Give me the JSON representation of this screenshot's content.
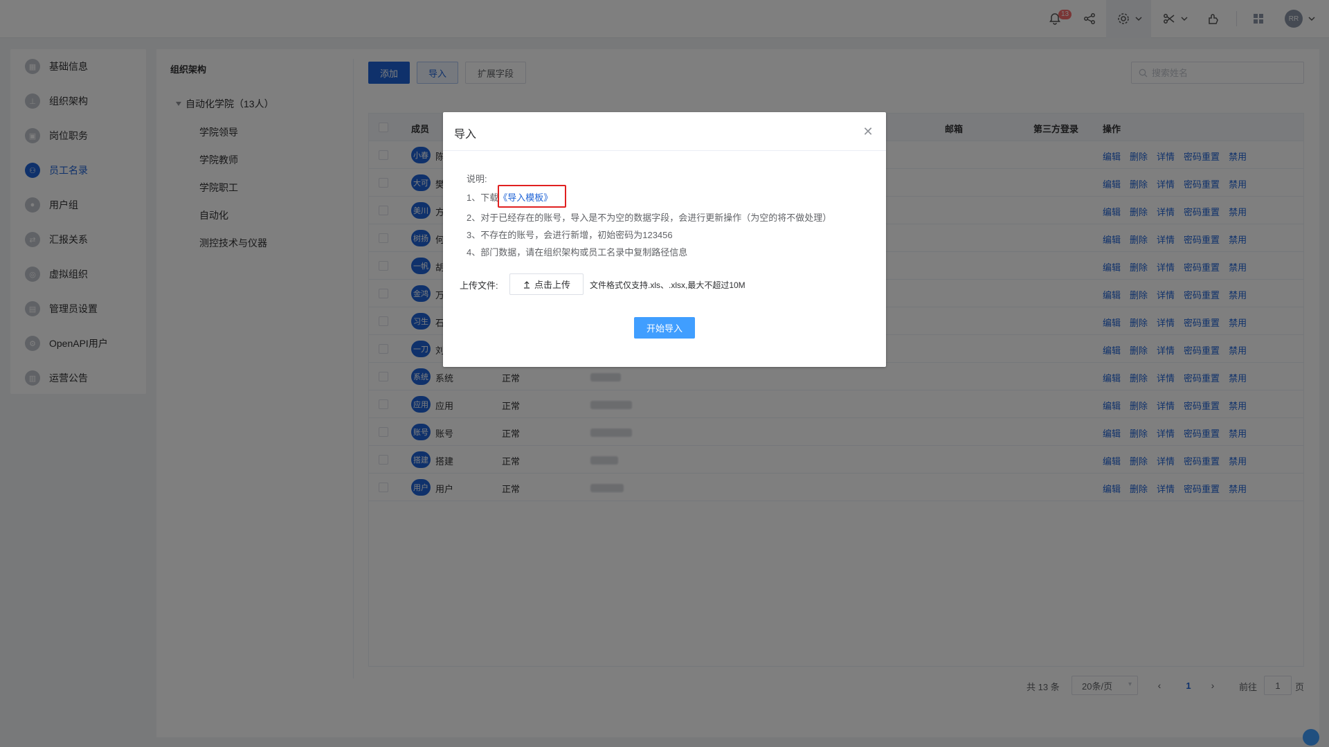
{
  "topbar": {
    "notification_count": "13",
    "avatar_initials": "RR"
  },
  "leftmenu": {
    "items": [
      {
        "label": "基础信息",
        "icon": "building-icon"
      },
      {
        "label": "组织架构",
        "icon": "org-tree-icon"
      },
      {
        "label": "岗位职务",
        "icon": "briefcase-icon"
      },
      {
        "label": "员工名录",
        "icon": "user-list-icon",
        "active": true
      },
      {
        "label": "用户组",
        "icon": "user-group-icon"
      },
      {
        "label": "汇报关系",
        "icon": "report-relation-icon"
      },
      {
        "label": "虚拟组织",
        "icon": "virtual-org-icon"
      },
      {
        "label": "管理员设置",
        "icon": "admin-settings-icon"
      },
      {
        "label": "OpenAPI用户",
        "icon": "api-icon"
      },
      {
        "label": "运营公告",
        "icon": "announcement-icon"
      }
    ]
  },
  "org": {
    "title": "组织架构",
    "root": "自动化学院（13人）",
    "children": [
      "学院领导",
      "学院教师",
      "学院职工",
      "自动化",
      "测控技术与仪器"
    ]
  },
  "toolbar": {
    "add_label": "添加",
    "import_label": "导入",
    "extend_label": "扩展字段",
    "search_placeholder": "搜索姓名"
  },
  "table": {
    "headers": {
      "member": "成员",
      "email": "邮箱",
      "third_party": "第三方登录",
      "ops": "操作"
    },
    "ops_labels": [
      "编辑",
      "删除",
      "详情",
      "密码重置",
      "禁用"
    ],
    "rows": [
      {
        "avatar": "小春",
        "name": "陈",
        "status": ""
      },
      {
        "avatar": "大可",
        "name": "樊",
        "status": ""
      },
      {
        "avatar": "美川",
        "name": "方",
        "status": ""
      },
      {
        "avatar": "树扬",
        "name": "何",
        "status": ""
      },
      {
        "avatar": "一帆",
        "name": "胡",
        "status": ""
      },
      {
        "avatar": "金鸿",
        "name": "万",
        "status": ""
      },
      {
        "avatar": "习生",
        "name": "石",
        "status": ""
      },
      {
        "avatar": "一刀",
        "name": "刘",
        "status": ""
      },
      {
        "avatar": "系统",
        "name": "系统",
        "status": "正常"
      },
      {
        "avatar": "应用",
        "name": "应用",
        "status": "正常"
      },
      {
        "avatar": "账号",
        "name": "账号",
        "status": "正常"
      },
      {
        "avatar": "搭建",
        "name": "搭建",
        "status": "正常"
      },
      {
        "avatar": "用户",
        "name": "用户",
        "status": "正常"
      }
    ]
  },
  "pagination": {
    "total": "共 13 条",
    "page_size": "20条/页",
    "current": "1",
    "goto_label": "前往",
    "goto_value": "1",
    "page_suffix": "页"
  },
  "dialog": {
    "title": "导入",
    "desc_label": "说明:",
    "line1_prefix": "1、下载",
    "template_link": "《导入模板》",
    "line2": "2、对于已经存在的账号，导入是不为空的数据字段，会进行更新操作（为空的将不做处理）",
    "line3": "3、不存在的账号，会进行新增，初始密码为123456",
    "line4": "4、部门数据，请在组织架构或员工名录中复制路径信息",
    "upload_label": "上传文件:",
    "upload_button": "点击上传",
    "upload_tip": "文件格式仅支持.xls、.xlsx,最大不超过10M",
    "start_button": "开始导入"
  }
}
